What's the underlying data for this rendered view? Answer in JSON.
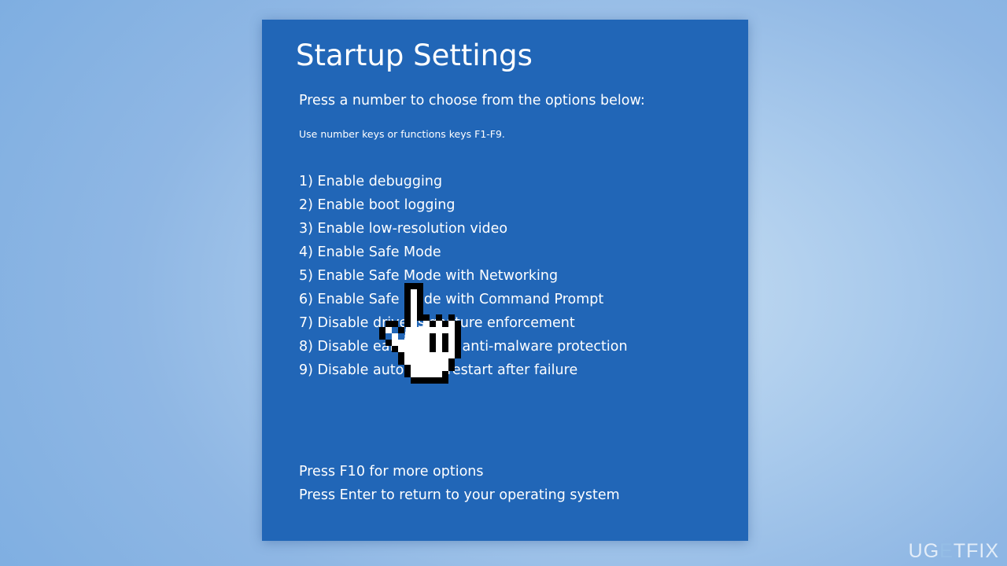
{
  "screen": {
    "title": "Startup Settings",
    "prompt": "Press a number to choose from the options below:",
    "hint": "Use number keys or functions keys F1-F9.",
    "options": [
      "1) Enable debugging",
      "2) Enable boot logging",
      "3) Enable low-resolution video",
      "4) Enable Safe Mode",
      "5) Enable Safe Mode with Networking",
      "6) Enable Safe Mode with Command Prompt",
      "7) Disable driver signature enforcement",
      "8) Disable early launch anti-malware protection",
      "9) Disable automatic restart after failure"
    ],
    "footer": {
      "more_options": "Press F10 for more options",
      "return": "Press Enter to return to your operating system"
    }
  },
  "watermark": {
    "part1": "UG",
    "part2": "E",
    "part3": "TFIX"
  },
  "colors": {
    "panel_background": "#2166b7",
    "page_background": "#8fb7e4",
    "text": "#ffffff"
  },
  "icons": {
    "pointer": "hand-pointer-cursor-icon"
  }
}
